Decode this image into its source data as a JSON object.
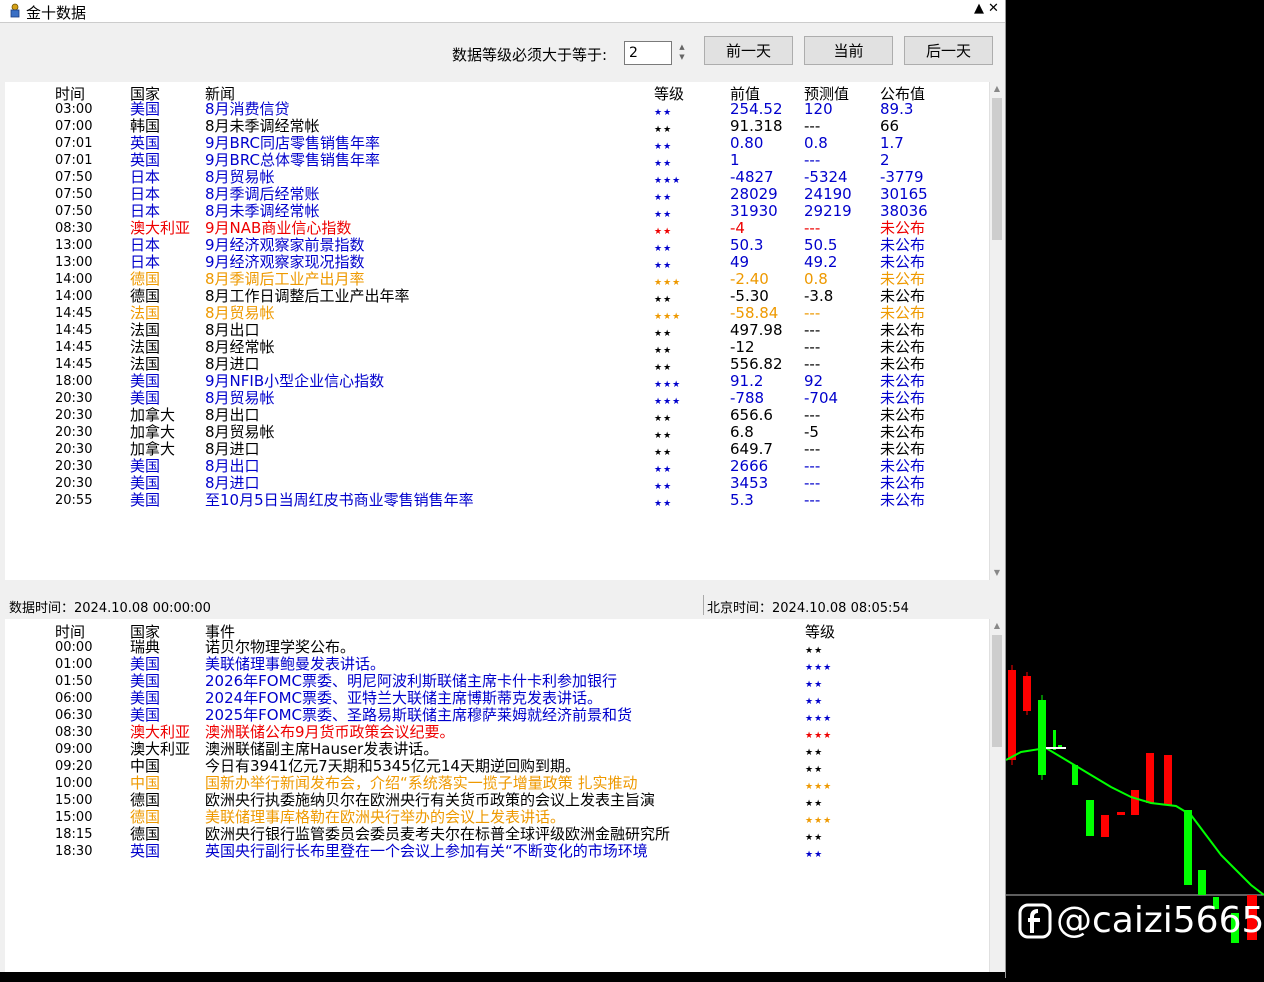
{
  "window": {
    "title": "金十数据"
  },
  "controls": {
    "level_label": "数据等级必须大于等于:",
    "level_value": "2",
    "prev_day": "前一天",
    "today": "当前",
    "next_day": "后一天"
  },
  "colors": {
    "blue": "#0000cc",
    "red": "#ee0000",
    "orange": "#ee9900",
    "black": "#000000"
  },
  "data_table": {
    "headers": {
      "time": "时间",
      "country": "国家",
      "news": "新闻",
      "level": "等级",
      "prev": "前值",
      "forecast": "预测值",
      "actual": "公布值"
    },
    "rows": [
      {
        "time": "03:00",
        "country": "美国",
        "news": "8月消费信贷",
        "level": "★★",
        "prev": "254.52",
        "forecast": "120",
        "actual": "89.3",
        "color": "blue"
      },
      {
        "time": "07:00",
        "country": "韩国",
        "news": "8月未季调经常帐",
        "level": "★★",
        "prev": "91.318",
        "forecast": "---",
        "actual": "66",
        "color": "black"
      },
      {
        "time": "07:01",
        "country": "英国",
        "news": "9月BRC同店零售销售年率",
        "level": "★★",
        "prev": "0.80",
        "forecast": "0.8",
        "actual": "1.7",
        "color": "blue"
      },
      {
        "time": "07:01",
        "country": "英国",
        "news": "9月BRC总体零售销售年率",
        "level": "★★",
        "prev": "1",
        "forecast": "---",
        "actual": "2",
        "color": "blue"
      },
      {
        "time": "07:50",
        "country": "日本",
        "news": "8月贸易帐",
        "level": "★★★",
        "prev": "-4827",
        "forecast": "-5324",
        "actual": "-3779",
        "color": "blue"
      },
      {
        "time": "07:50",
        "country": "日本",
        "news": "8月季调后经常账",
        "level": "★★",
        "prev": "28029",
        "forecast": "24190",
        "actual": "30165",
        "color": "blue"
      },
      {
        "time": "07:50",
        "country": "日本",
        "news": "8月未季调经常帐",
        "level": "★★",
        "prev": "31930",
        "forecast": "29219",
        "actual": "38036",
        "color": "blue"
      },
      {
        "time": "08:30",
        "country": "澳大利亚",
        "news": "9月NAB商业信心指数",
        "level": "★★",
        "prev": "-4",
        "forecast": "---",
        "actual": "未公布",
        "color": "red"
      },
      {
        "time": "13:00",
        "country": "日本",
        "news": "9月经济观察家前景指数",
        "level": "★★",
        "prev": "50.3",
        "forecast": "50.5",
        "actual": "未公布",
        "color": "blue"
      },
      {
        "time": "13:00",
        "country": "日本",
        "news": "9月经济观察家现况指数",
        "level": "★★",
        "prev": "49",
        "forecast": "49.2",
        "actual": "未公布",
        "color": "blue"
      },
      {
        "time": "14:00",
        "country": "德国",
        "news": "8月季调后工业产出月率",
        "level": "★★★",
        "prev": "-2.40",
        "forecast": "0.8",
        "actual": "未公布",
        "color": "orange"
      },
      {
        "time": "14:00",
        "country": "德国",
        "news": "8月工作日调整后工业产出年率",
        "level": "★★",
        "prev": "-5.30",
        "forecast": "-3.8",
        "actual": "未公布",
        "color": "black"
      },
      {
        "time": "14:45",
        "country": "法国",
        "news": "8月贸易帐",
        "level": "★★★",
        "prev": "-58.84",
        "forecast": "---",
        "actual": "未公布",
        "color": "orange"
      },
      {
        "time": "14:45",
        "country": "法国",
        "news": "8月出口",
        "level": "★★",
        "prev": "497.98",
        "forecast": "---",
        "actual": "未公布",
        "color": "black"
      },
      {
        "time": "14:45",
        "country": "法国",
        "news": "8月经常帐",
        "level": "★★",
        "prev": "-12",
        "forecast": "---",
        "actual": "未公布",
        "color": "black"
      },
      {
        "time": "14:45",
        "country": "法国",
        "news": "8月进口",
        "level": "★★",
        "prev": "556.82",
        "forecast": "---",
        "actual": "未公布",
        "color": "black"
      },
      {
        "time": "18:00",
        "country": "美国",
        "news": "9月NFIB小型企业信心指数",
        "level": "★★★",
        "prev": "91.2",
        "forecast": "92",
        "actual": "未公布",
        "color": "blue"
      },
      {
        "time": "20:30",
        "country": "美国",
        "news": "8月贸易帐",
        "level": "★★★",
        "prev": "-788",
        "forecast": "-704",
        "actual": "未公布",
        "color": "blue"
      },
      {
        "time": "20:30",
        "country": "加拿大",
        "news": "8月出口",
        "level": "★★",
        "prev": "656.6",
        "forecast": "---",
        "actual": "未公布",
        "color": "black"
      },
      {
        "time": "20:30",
        "country": "加拿大",
        "news": "8月贸易帐",
        "level": "★★",
        "prev": "6.8",
        "forecast": "-5",
        "actual": "未公布",
        "color": "black"
      },
      {
        "time": "20:30",
        "country": "加拿大",
        "news": "8月进口",
        "level": "★★",
        "prev": "649.7",
        "forecast": "---",
        "actual": "未公布",
        "color": "black"
      },
      {
        "time": "20:30",
        "country": "美国",
        "news": "8月出口",
        "level": "★★",
        "prev": "2666",
        "forecast": "---",
        "actual": "未公布",
        "color": "blue"
      },
      {
        "time": "20:30",
        "country": "美国",
        "news": "8月进口",
        "level": "★★",
        "prev": "3453",
        "forecast": "---",
        "actual": "未公布",
        "color": "blue"
      },
      {
        "time": "20:55",
        "country": "美国",
        "news": "至10月5日当周红皮书商业零售销售年率",
        "level": "★★",
        "prev": "5.3",
        "forecast": "---",
        "actual": "未公布",
        "color": "blue"
      }
    ]
  },
  "status": {
    "data_time": "数据时间：2024.10.08 00:00:00",
    "beijing_time": "北京时间：2024.10.08 08:05:54"
  },
  "event_table": {
    "headers": {
      "time": "时间",
      "country": "国家",
      "event": "事件",
      "level": "等级"
    },
    "rows": [
      {
        "time": "00:00",
        "country": "瑞典",
        "event": "诺贝尔物理学奖公布。",
        "level": "★★",
        "color": "black"
      },
      {
        "time": "01:00",
        "country": "美国",
        "event": "美联储理事鲍曼发表讲话。",
        "level": "★★★",
        "color": "blue"
      },
      {
        "time": "01:50",
        "country": "美国",
        "event": "2026年FOMC票委、明尼阿波利斯联储主席卡什卡利参加银行",
        "level": "★★",
        "color": "blue"
      },
      {
        "time": "06:00",
        "country": "美国",
        "event": "2024年FOMC票委、亚特兰大联储主席博斯蒂克发表讲话。",
        "level": "★★",
        "color": "blue"
      },
      {
        "time": "06:30",
        "country": "美国",
        "event": "2025年FOMC票委、圣路易斯联储主席穆萨莱姆就经济前景和货",
        "level": "★★★",
        "color": "blue"
      },
      {
        "time": "08:30",
        "country": "澳大利亚",
        "event": "澳洲联储公布9月货币政策会议纪要。",
        "level": "★★★",
        "color": "red"
      },
      {
        "time": "09:00",
        "country": "澳大利亚",
        "event": "澳洲联储副主席Hauser发表讲话。",
        "level": "★★",
        "color": "black"
      },
      {
        "time": "09:20",
        "country": "中国",
        "event": "今日有3941亿元7天期和5345亿元14天期逆回购到期。",
        "level": "★★",
        "color": "black"
      },
      {
        "time": "10:00",
        "country": "中国",
        "event": "国新办举行新闻发布会，介绍“系统落实一揽子增量政策 扎实推动",
        "level": "★★★",
        "color": "orange"
      },
      {
        "time": "15:00",
        "country": "德国",
        "event": "欧洲央行执委施纳贝尔在欧洲央行有关货币政策的会议上发表主旨演",
        "level": "★★",
        "color": "black"
      },
      {
        "time": "15:00",
        "country": "德国",
        "event": "美联储理事库格勒在欧洲央行举办的会议上发表讲话。",
        "level": "★★★",
        "color": "orange"
      },
      {
        "time": "18:15",
        "country": "德国",
        "event": "欧洲央行银行监管委员会委员麦考夫尔在标普全球评级欧洲金融研究所",
        "level": "★★",
        "color": "black"
      },
      {
        "time": "18:30",
        "country": "英国",
        "event": "英国央行副行长布里登在一个会议上参加有关“不断变化的市场环境",
        "level": "★★",
        "color": "blue"
      }
    ]
  },
  "watermark": {
    "text": "@caizi5665"
  }
}
